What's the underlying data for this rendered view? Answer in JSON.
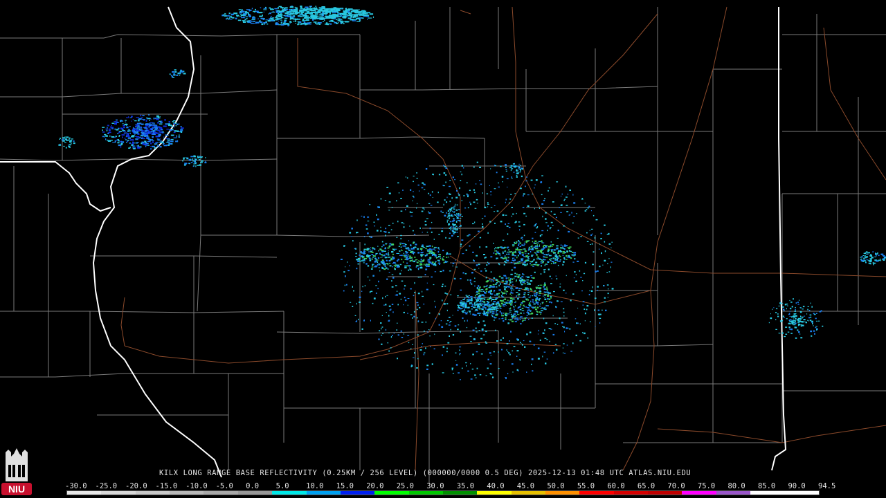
{
  "caption": {
    "text": "KILX LONG RANGE BASE REFLECTIVITY (0.25KM / 256 LEVEL) (000000/0000 0.5 DEG) 2025-12-13 01:48 UTC  ATLAS.NIU.EDU"
  },
  "logo": {
    "text": "NIU",
    "color": "#c8102e"
  },
  "legend": {
    "labels": [
      "-30.0",
      "-25.0",
      "-20.0",
      "-15.0",
      "-10.0",
      "-5.0",
      "0.0",
      "5.0",
      "10.0",
      "15.0",
      "20.0",
      "25.0",
      "30.0",
      "35.0",
      "40.0",
      "45.0",
      "50.0",
      "55.0",
      "60.0",
      "65.0",
      "70.0",
      "75.0",
      "80.0",
      "85.0",
      "90.0",
      "94.5"
    ],
    "colors": [
      "#e8e8e8",
      "#d8d8d8",
      "#c8c8c8",
      "#b8b8b8",
      "#a8a8a8",
      "#989898",
      "#00e8e8",
      "#00a0f0",
      "#0020f0",
      "#00ff00",
      "#00c800",
      "#009000",
      "#ffff00",
      "#e7c000",
      "#ff9000",
      "#ff0000",
      "#d60000",
      "#c00000",
      "#ff00ff",
      "#9955c9",
      "#ffffff",
      "#ffffff"
    ]
  },
  "map": {
    "colors": {
      "background": "#000000",
      "county_lines": "#7a7a7a",
      "state_lines": "#ffffff",
      "highways": "#8b4a2b",
      "echo_light": "#29c7e0",
      "echo_mid": "#1a7ff0",
      "echo_deep": "#1030e0",
      "echo_green": "#3fcf5a"
    }
  }
}
